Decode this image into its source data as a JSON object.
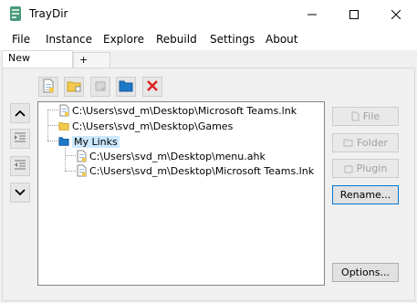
{
  "window": {
    "title": "TrayDir",
    "controls": {
      "minimize": "—",
      "maximize": "☐",
      "close": "✕"
    }
  },
  "menu": [
    "File",
    "Instance",
    "Explore",
    "Rebuild",
    "Settings",
    "About"
  ],
  "tabs": [
    {
      "label": "New Instance",
      "active": true
    },
    {
      "label": "+",
      "active": false
    }
  ],
  "toolbar": {
    "icons": [
      "add-file-icon",
      "add-folder-icon",
      "add-plugin-icon",
      "add-group-icon",
      "delete-icon"
    ]
  },
  "side_controls": {
    "icons": [
      "move-up-icon",
      "indent-icon",
      "outdent-icon",
      "move-down-icon"
    ]
  },
  "tree": {
    "items": [
      {
        "label": "C:\\Users\\svd_m\\Desktop\\Microsoft Teams.lnk",
        "icon": "file-icon",
        "level": 0
      },
      {
        "label": "C:\\Users\\svd_m\\Desktop\\Games",
        "icon": "folder-icon",
        "level": 0
      },
      {
        "label": "My Links",
        "icon": "group-folder-icon",
        "level": 0,
        "selected": true
      },
      {
        "label": "C:\\Users\\svd_m\\Desktop\\menu.ahk",
        "icon": "file-icon",
        "level": 1
      },
      {
        "label": "C:\\Users\\svd_m\\Desktop\\Microsoft Teams.lnk",
        "icon": "file-icon",
        "level": 1
      }
    ]
  },
  "actions": {
    "file": "File",
    "folder": "Folder",
    "plugin": "Plugin",
    "rename": "Rename...",
    "options": "Options..."
  },
  "colors": {
    "folder_yellow": "#f2c94c",
    "group_blue": "#1e78c8",
    "delete_red": "#e02020",
    "selection": "#cce8ff"
  }
}
